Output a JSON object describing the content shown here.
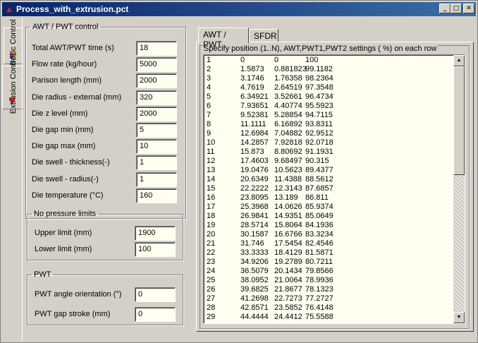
{
  "window": {
    "title": "Process_with_extrusion.pct",
    "buttons": {
      "minimize": "_",
      "maximize": "□",
      "close": "✕"
    }
  },
  "side_tabs": [
    {
      "label": "Basic Control",
      "icon": "shapes-icon"
    },
    {
      "label": "Extrusion Control",
      "icon": "extruder-icon"
    }
  ],
  "awt_pwt_control": {
    "legend": "AWT / PWT control",
    "fields": [
      {
        "label": "Total AWT/PWT time (s)",
        "value": "18"
      },
      {
        "label": "Flow rate (kg/hour)",
        "value": "5000"
      },
      {
        "label": "Parison length (mm)",
        "value": "2000"
      },
      {
        "label": "Die radius - external (mm)",
        "value": "320"
      },
      {
        "label": "Die z level (mm)",
        "value": "2000"
      },
      {
        "label": "Die gap min (mm)",
        "value": "5"
      },
      {
        "label": "Die gap max (mm)",
        "value": "10"
      },
      {
        "label": "Die swell - thickness(-)",
        "value": "1"
      },
      {
        "label": "Die swell - radius(-)",
        "value": "1"
      },
      {
        "label": "Die temperature (°C)",
        "value": "160"
      }
    ]
  },
  "no_pressure_limits": {
    "legend": "No pressure limits",
    "fields": [
      {
        "label": "Upper limit (mm)",
        "value": "1900"
      },
      {
        "label": "Lower limit (mm)",
        "value": "100"
      }
    ]
  },
  "pwt": {
    "legend": "PWT",
    "fields": [
      {
        "label": "PWT angle orientation (°)",
        "value": "0"
      },
      {
        "label": "PWT gap stroke (mm)",
        "value": "0"
      }
    ]
  },
  "tabs": [
    {
      "label": "AWT / PWT",
      "active": true
    },
    {
      "label": "SFDR",
      "active": false
    }
  ],
  "list_caption": "Specify position (1..N), AWT,PWT1,PWT2 settings ( %) on each row",
  "list_rows": [
    [
      "1",
      "0",
      "0",
      "100"
    ],
    [
      "2",
      "1.5873",
      "0.881823",
      "99.1182"
    ],
    [
      "3",
      "3.1746",
      "1.76358",
      "98.2364"
    ],
    [
      "4",
      "4.7619",
      "2.64519",
      "97.3548"
    ],
    [
      "5",
      "6.34921",
      "3.52661",
      "96.4734"
    ],
    [
      "6",
      "7.93651",
      "4.40774",
      "95.5923"
    ],
    [
      "7",
      "9.52381",
      "5.28854",
      "94.7115"
    ],
    [
      "8",
      "11.1111",
      "6.16892",
      "93.8311"
    ],
    [
      "9",
      "12.6984",
      "7.04882",
      "92.9512"
    ],
    [
      "10",
      "14.2857",
      "7.92818",
      "92.0718"
    ],
    [
      "11",
      "15.873",
      "8.80692",
      "91.1931"
    ],
    [
      "12",
      "17.4603",
      "9.68497",
      "90.315"
    ],
    [
      "13",
      "19.0476",
      "10.5623",
      "89.4377"
    ],
    [
      "14",
      "20.6349",
      "11.4388",
      "88.5612"
    ],
    [
      "15",
      "22.2222",
      "12.3143",
      "87.6857"
    ],
    [
      "16",
      "23.8095",
      "13.189",
      "86.811"
    ],
    [
      "17",
      "25.3968",
      "14.0626",
      "85.9374"
    ],
    [
      "18",
      "26.9841",
      "14.9351",
      "85.0649"
    ],
    [
      "19",
      "28.5714",
      "15.8064",
      "84.1936"
    ],
    [
      "20",
      "30.1587",
      "16.6766",
      "83.3234"
    ],
    [
      "21",
      "31.746",
      "17.5454",
      "82.4546"
    ],
    [
      "22",
      "33.3333",
      "18.4129",
      "81.5871"
    ],
    [
      "23",
      "34.9206",
      "19.2789",
      "80.7211"
    ],
    [
      "24",
      "36.5079",
      "20.1434",
      "79.8566"
    ],
    [
      "25",
      "38.0952",
      "21.0064",
      "78.9936"
    ],
    [
      "26",
      "39.6825",
      "21.8677",
      "78.1323"
    ],
    [
      "27",
      "41.2698",
      "22.7273",
      "77.2727"
    ],
    [
      "28",
      "42.8571",
      "23.5852",
      "76.4148"
    ],
    [
      "29",
      "44.4444",
      "24.4412",
      "75.5588"
    ]
  ],
  "colors": {
    "titlebar_start": "#0a246a",
    "titlebar_end": "#3a6ea5",
    "field_bg": "#fffff0"
  }
}
